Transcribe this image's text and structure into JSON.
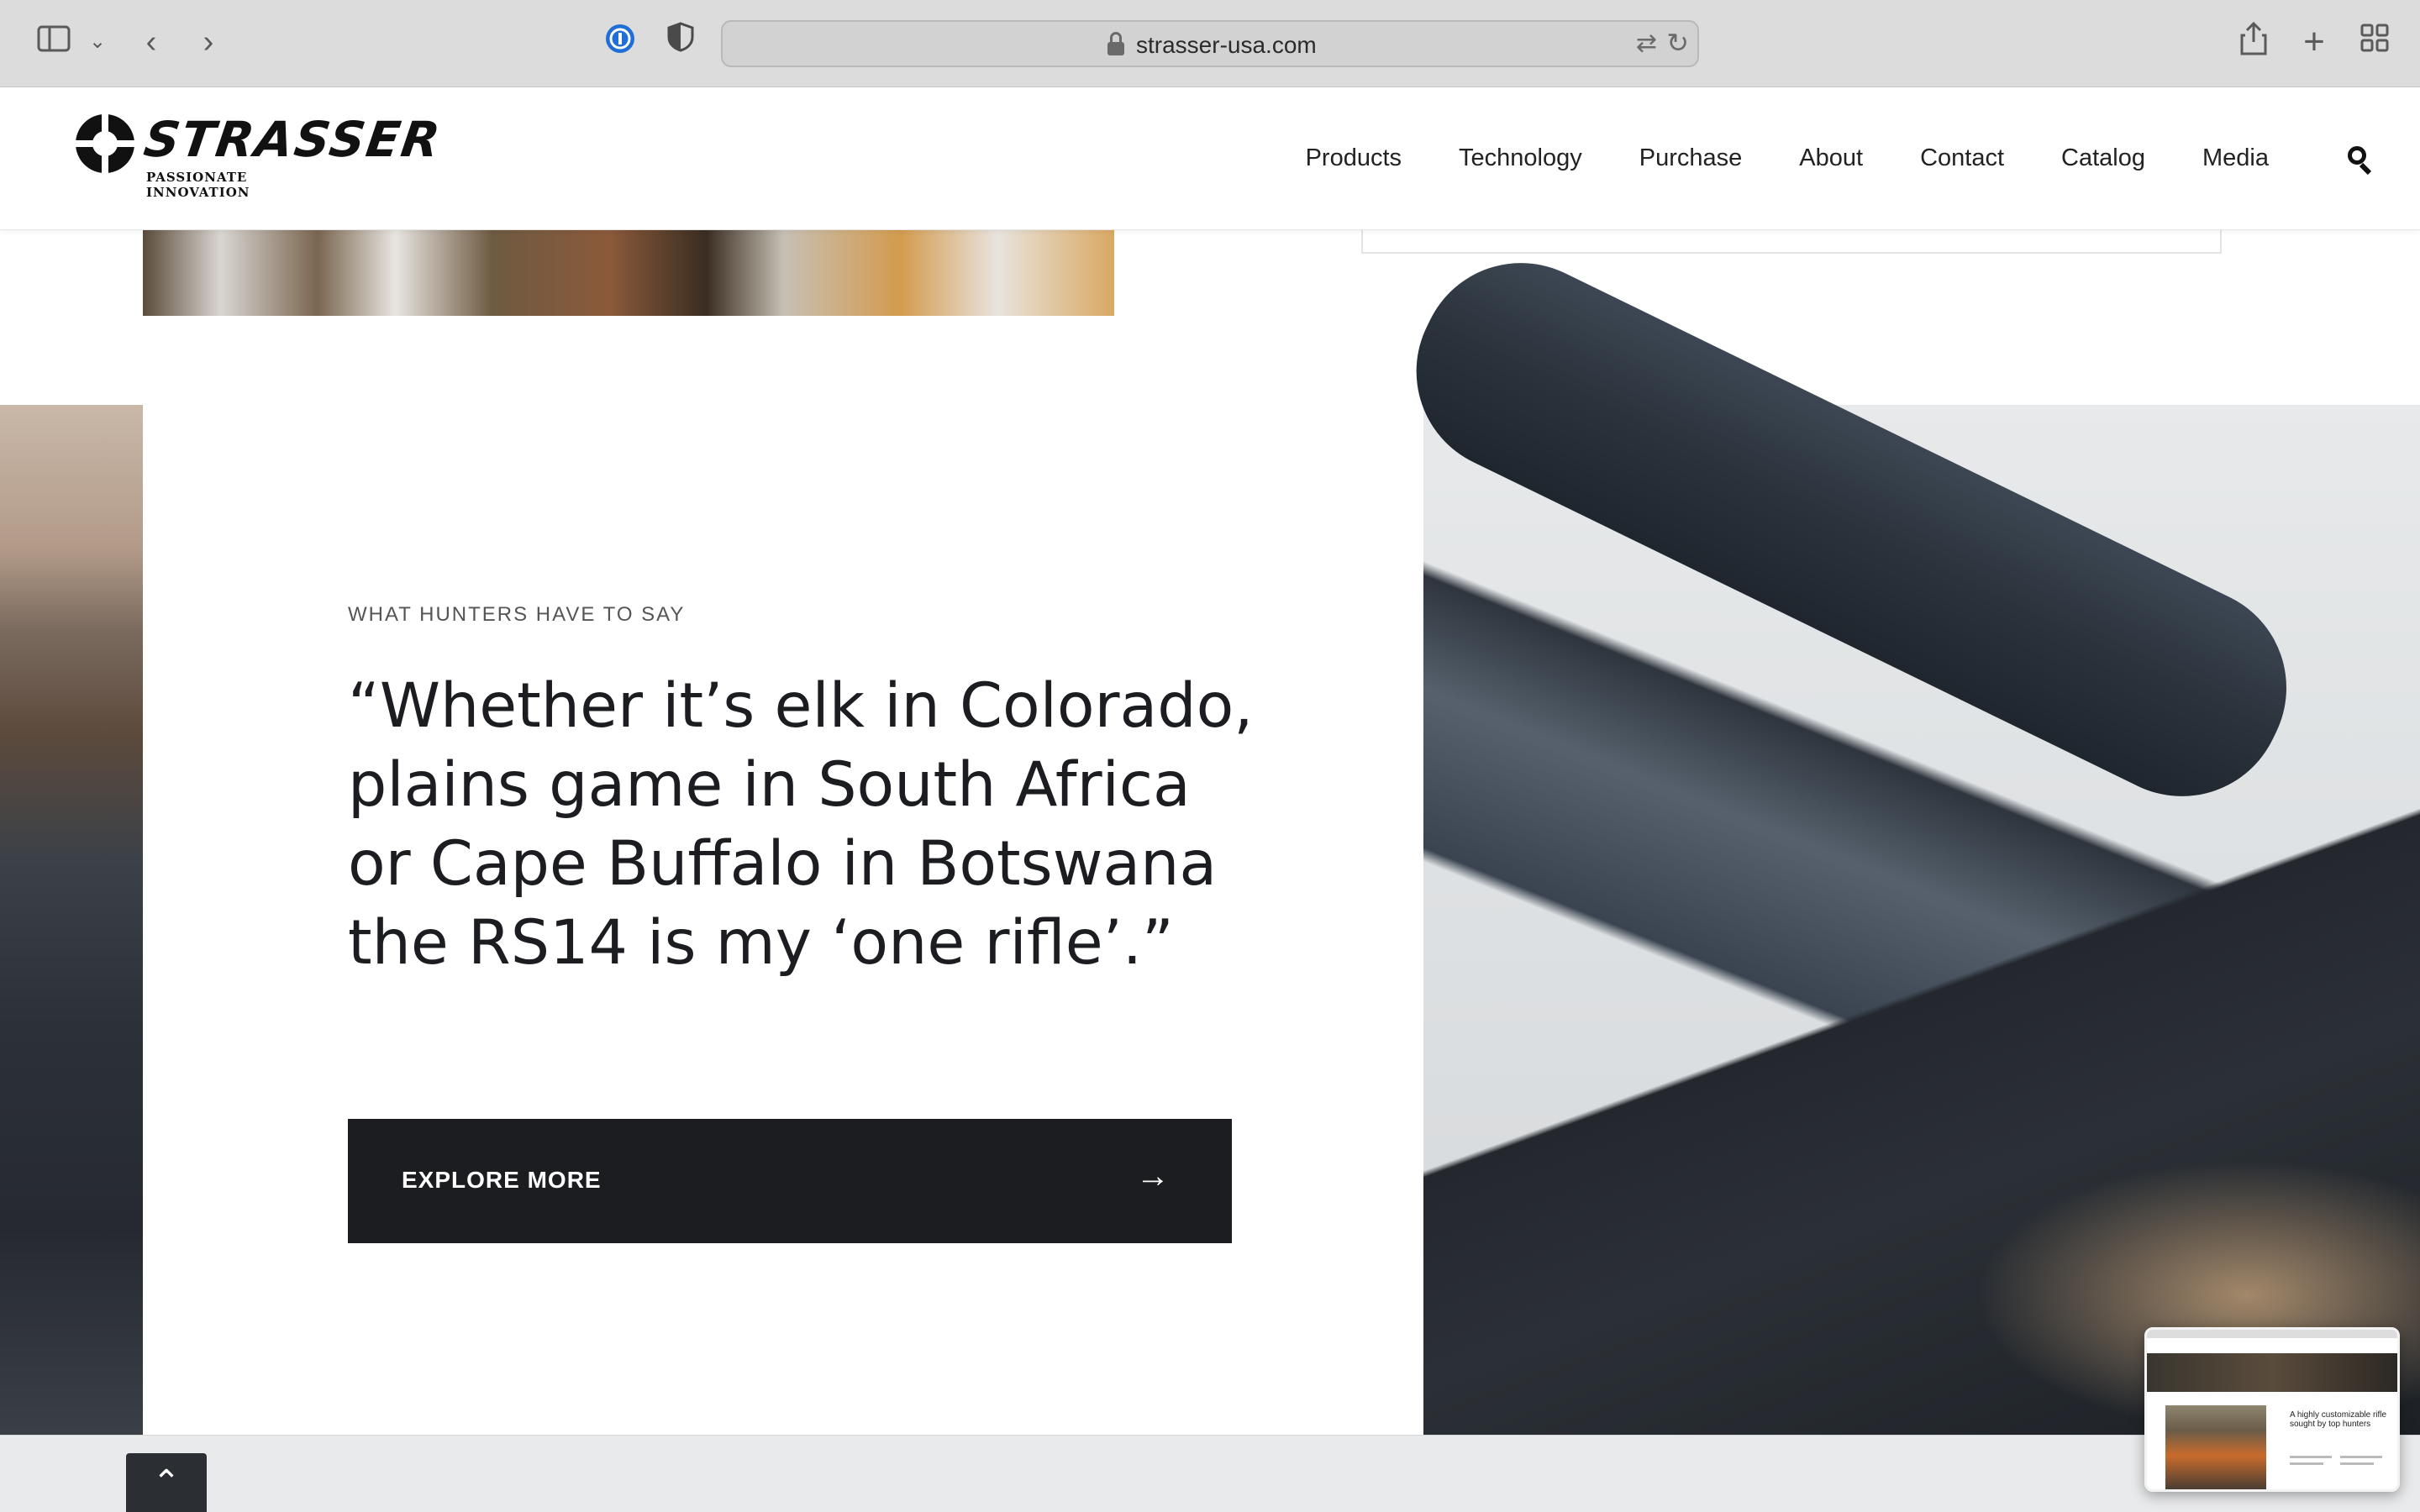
{
  "browser": {
    "url": "strasser-usa.com",
    "icons": [
      "sidebar-icon",
      "chevron-down-icon",
      "back-icon",
      "forward-icon",
      "password-icon",
      "shield-icon",
      "lock-icon",
      "translate-icon",
      "reload-icon",
      "share-icon",
      "new-tab-icon",
      "tab-overview-icon"
    ]
  },
  "header": {
    "logo_word": "STRASSER",
    "logo_tagline": "PASSIONATE INNOVATION",
    "nav": [
      {
        "label": "Products"
      },
      {
        "label": "Technology"
      },
      {
        "label": "Purchase"
      },
      {
        "label": "About"
      },
      {
        "label": "Contact"
      },
      {
        "label": "Catalog"
      },
      {
        "label": "Media"
      }
    ]
  },
  "testimonial": {
    "eyebrow": "WHAT HUNTERS HAVE TO SAY",
    "quote": "“Whether it’s elk in Colorado, plains game in South Africa or Cape Buffalo in Botswana the RS14 is my ‘one rifle’.”",
    "cta_label": "EXPLORE MORE",
    "cta_arrow": "→"
  },
  "thumbnail": {
    "title": "A highly customizable rifle sought by top hunters"
  },
  "colors": {
    "dark": "#1b1d21",
    "chrome": "#dcdcdc",
    "band": "#e9eaeb"
  }
}
